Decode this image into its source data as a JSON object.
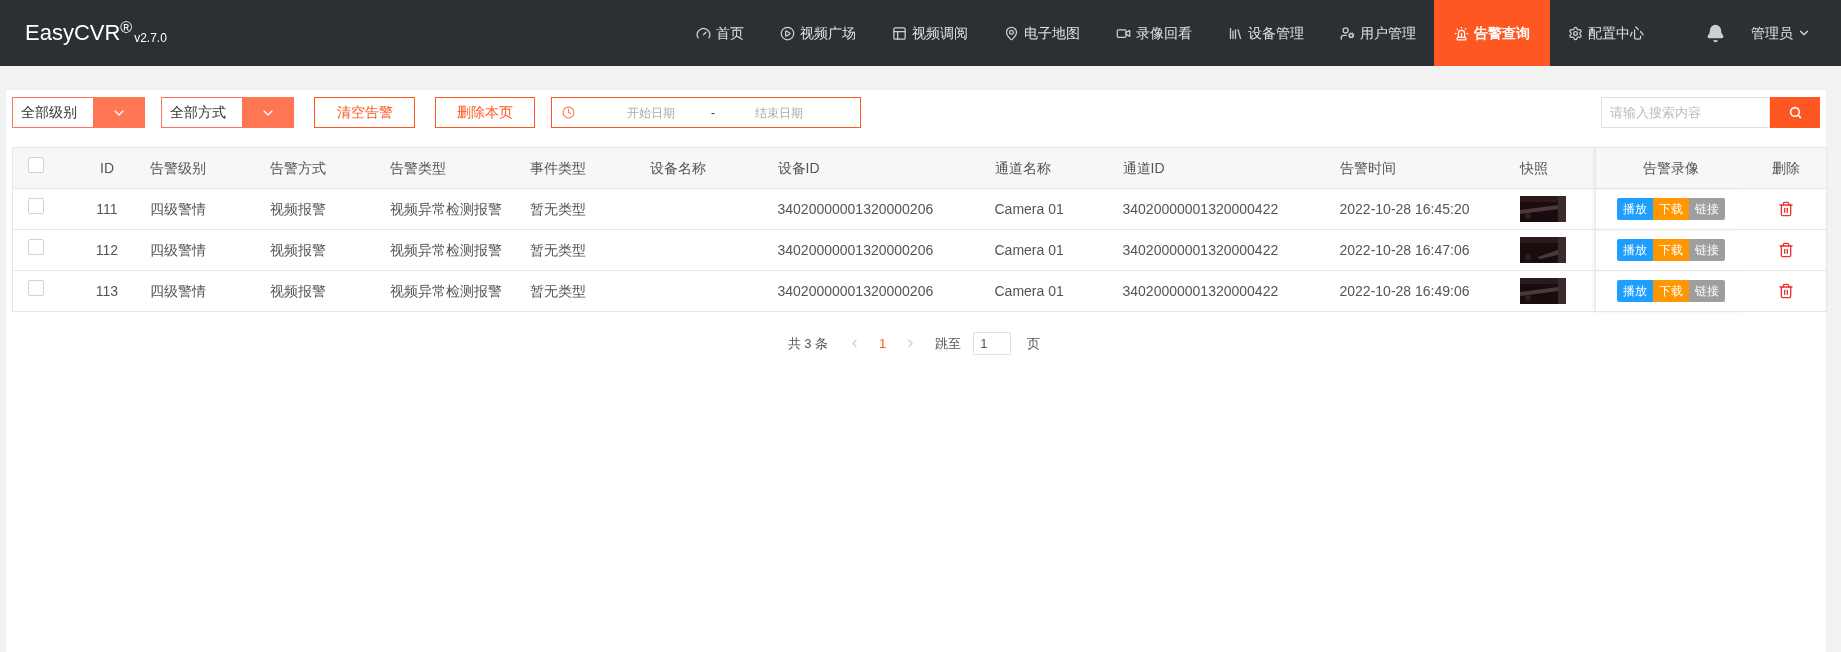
{
  "header": {
    "logo": "EasyCVR",
    "logo_mark": "®",
    "version": "v2.7.0",
    "nav": [
      {
        "label": "首页",
        "selected": false
      },
      {
        "label": "视频广场",
        "selected": false
      },
      {
        "label": "视频调阅",
        "selected": false
      },
      {
        "label": "电子地图",
        "selected": false
      },
      {
        "label": "录像回看",
        "selected": false
      },
      {
        "label": "设备管理",
        "selected": false
      },
      {
        "label": "用户管理",
        "selected": false
      },
      {
        "label": "告警查询",
        "selected": true
      },
      {
        "label": "配置中心",
        "selected": false
      }
    ],
    "user": "管理员"
  },
  "toolbar": {
    "level_select": "全部级别",
    "method_select": "全部方式",
    "clear_button": "清空告警",
    "delete_page_button": "删除本页",
    "date_range": {
      "start_placeholder": "开始日期",
      "separator": "-",
      "end_placeholder": "结束日期"
    },
    "search": {
      "placeholder": "请输入搜索内容"
    }
  },
  "table": {
    "columns": [
      "ID",
      "告警级别",
      "告警方式",
      "告警类型",
      "事件类型",
      "设备名称",
      "设备ID",
      "通道名称",
      "通道ID",
      "告警时间",
      "快照",
      "告警录像",
      "删除"
    ],
    "header_checked": false,
    "rows": [
      {
        "checked": false,
        "id": "111",
        "level": "四级警情",
        "method": "视频报警",
        "type": "视频异常检测报警",
        "event": "暂无类型",
        "device_id": "34020000001320000206",
        "channel_name": "Camera 01",
        "channel_id": "34020000001320000422",
        "time": "2022-10-28 16:45:20",
        "actions": [
          "播放",
          "下载",
          "链接"
        ]
      },
      {
        "checked": false,
        "id": "112",
        "level": "四级警情",
        "method": "视频报警",
        "type": "视频异常检测报警",
        "event": "暂无类型",
        "device_id": "34020000001320000206",
        "channel_name": "Camera 01",
        "channel_id": "34020000001320000422",
        "time": "2022-10-28 16:47:06",
        "actions": [
          "播放",
          "下载",
          "链接"
        ]
      },
      {
        "checked": false,
        "id": "113",
        "level": "四级警情",
        "method": "视频报警",
        "type": "视频异常检测报警",
        "event": "暂无类型",
        "device_id": "34020000001320000206",
        "channel_name": "Camera 01",
        "channel_id": "34020000001320000422",
        "time": "2022-10-28 16:49:06",
        "actions": [
          "播放",
          "下载",
          "链接"
        ]
      }
    ]
  },
  "pagination": {
    "total": "共 3 条",
    "pages": [
      {
        "label": "1",
        "selected": true
      }
    ],
    "jump_label": "跳至",
    "jump_value": "1",
    "page_unit": "页"
  }
}
